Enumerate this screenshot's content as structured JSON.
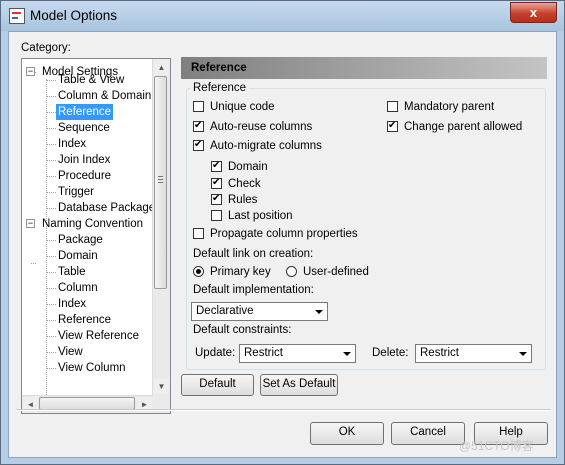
{
  "window": {
    "title": "Model Options",
    "close_glyph": "x"
  },
  "category_label": "Category:",
  "tree": {
    "items": [
      {
        "label": "Model Settings",
        "expander": "−"
      },
      {
        "label": "Table & View"
      },
      {
        "label": "Column & Domain"
      },
      {
        "label": "Reference"
      },
      {
        "label": "Sequence"
      },
      {
        "label": "Index"
      },
      {
        "label": "Join Index"
      },
      {
        "label": "Procedure"
      },
      {
        "label": "Trigger"
      },
      {
        "label": "Database Package"
      },
      {
        "label": "Naming Convention",
        "expander": "−"
      },
      {
        "label": "Package"
      },
      {
        "label": "Domain"
      },
      {
        "label": "Table"
      },
      {
        "label": "Column"
      },
      {
        "label": "Index"
      },
      {
        "label": "Reference"
      },
      {
        "label": "View Reference"
      },
      {
        "label": "View"
      },
      {
        "label": "View Column"
      }
    ],
    "scroll_up": "▲",
    "scroll_down": "▼",
    "scroll_left": "◄",
    "scroll_right": "►"
  },
  "panel": {
    "header": "Reference",
    "group_title": "Reference",
    "checkboxes": {
      "unique_code": "Unique code",
      "auto_reuse_columns": "Auto-reuse columns",
      "auto_migrate_columns": "Auto-migrate columns",
      "domain": "Domain",
      "check": "Check",
      "rules": "Rules",
      "last_position": "Last position",
      "propagate_column_properties": "Propagate column properties",
      "mandatory_parent": "Mandatory parent",
      "change_parent_allowed": "Change parent allowed"
    },
    "default_link_label": "Default link on creation:",
    "radio_primary_key": "Primary key",
    "radio_user_defined": "User-defined",
    "default_implementation_label": "Default implementation:",
    "default_implementation_value": "Declarative",
    "default_constraints_label": "Default constraints:",
    "update_label": "Update:",
    "update_value": "Restrict",
    "delete_label": "Delete:",
    "delete_value": "Restrict"
  },
  "buttons": {
    "default": "Default",
    "set_as_default": "Set As Default",
    "ok": "OK",
    "cancel": "Cancel",
    "help": "Help"
  },
  "watermark": "@51CTO博客"
}
